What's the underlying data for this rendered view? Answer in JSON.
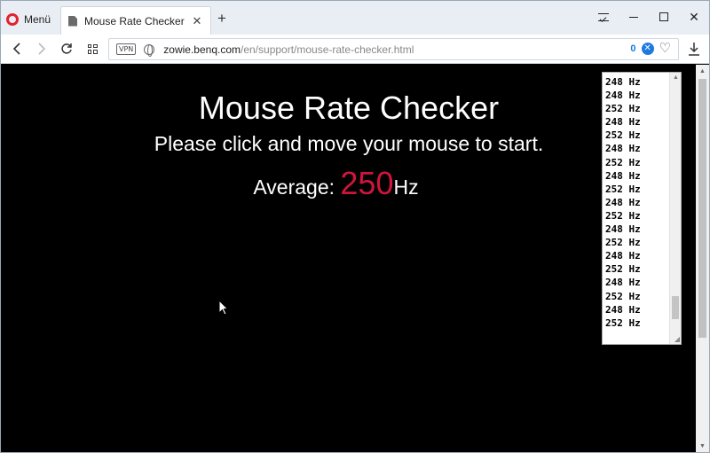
{
  "browser": {
    "menu_label": "Menü",
    "tab_title": "Mouse Rate Checker",
    "tab_close": "✕",
    "new_tab": "+",
    "vpn_label": "VPN",
    "url_domain": "zowie.benq.com",
    "url_path": "/en/support/mouse-rate-checker.html",
    "blocked_count": "0",
    "blocker_glyph": "✕",
    "accent_color": "#1e7ae0",
    "opera_color": "#e3222c"
  },
  "page": {
    "title": "Mouse Rate Checker",
    "subtitle": "Please click and move your mouse to start.",
    "average_label": "Average:",
    "average_value": "250",
    "average_unit": "Hz",
    "average_color": "#d0143e"
  },
  "log": {
    "lines": [
      "248 Hz",
      "248 Hz",
      "252 Hz",
      "248 Hz",
      "252 Hz",
      "248 Hz",
      "252 Hz",
      "248 Hz",
      "252 Hz",
      "248 Hz",
      "252 Hz",
      "248 Hz",
      "252 Hz",
      "248 Hz",
      "252 Hz",
      "248 Hz",
      "252 Hz",
      "248 Hz",
      "252 Hz"
    ]
  }
}
